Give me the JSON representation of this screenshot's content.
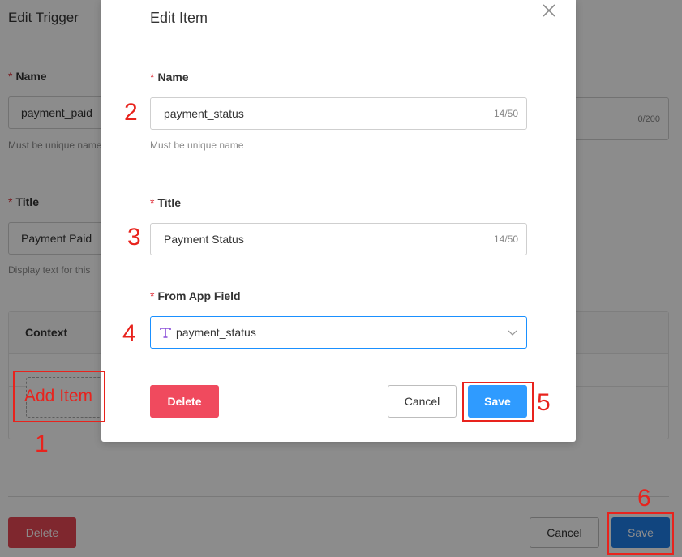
{
  "background": {
    "title": "Edit Trigger",
    "name_label": "Name",
    "name_value": "payment_paid",
    "name_hint": "Must be unique name",
    "title_label": "Title",
    "title_value": "Payment Paid",
    "title_hint": "Display text for this",
    "description_counter": "0/200",
    "context_header": "Context",
    "delete_label": "Delete",
    "cancel_label": "Cancel",
    "save_label": "Save"
  },
  "modal": {
    "title": "Edit Item",
    "name": {
      "label": "Name",
      "value": "payment_status",
      "counter": "14/50",
      "hint": "Must be unique name"
    },
    "title_field": {
      "label": "Title",
      "value": "Payment Status",
      "counter": "14/50"
    },
    "app_field": {
      "label": "From App Field",
      "value": "payment_status",
      "icon": "text-type-icon"
    },
    "delete_label": "Delete",
    "cancel_label": "Cancel",
    "save_label": "Save"
  },
  "annotations": {
    "add_item_text": "Add Item",
    "n1": "1",
    "n2": "2",
    "n3": "3",
    "n4": "4",
    "n5": "5",
    "n6": "6"
  },
  "colors": {
    "annotation": "#e8231d",
    "primary": "#2f9bff",
    "danger": "#f04a5e"
  }
}
